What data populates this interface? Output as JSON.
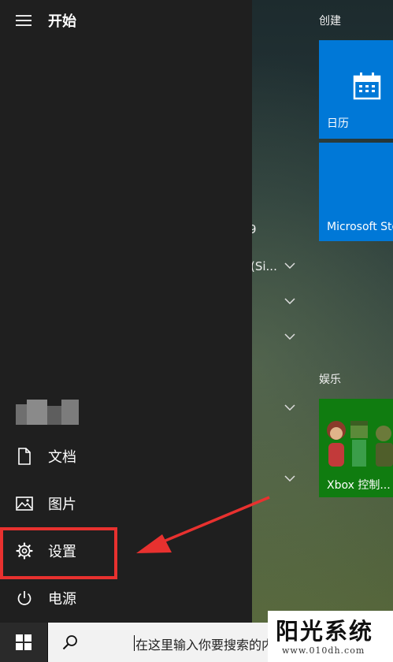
{
  "start_menu": {
    "title": "开始",
    "items": [
      {
        "label": "文档",
        "icon": "document-icon"
      },
      {
        "label": "图片",
        "icon": "pictures-icon"
      },
      {
        "label": "设置",
        "icon": "gear-icon"
      },
      {
        "label": "电源",
        "icon": "power-icon"
      }
    ]
  },
  "app_list_peek": {
    "fragment_1": "9",
    "fragment_2": "(Si..."
  },
  "tiles": {
    "group_create": "创建",
    "calendar_label": "日历",
    "store_label": "Microsoft Sto",
    "group_entertainment": "娱乐",
    "xbox_label": "Xbox 控制..."
  },
  "taskbar": {
    "search_placeholder": "在这里输入你要搜索的内容"
  },
  "watermark": {
    "title": "阳光系统",
    "url": "www.010dh.com"
  },
  "colors": {
    "accent": "#0078d7",
    "xbox": "#107c10",
    "highlight": "#e8312f",
    "arrow": "#e8312f"
  }
}
